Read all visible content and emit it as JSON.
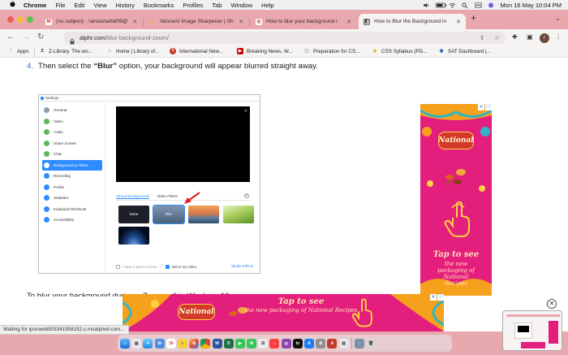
{
  "menubar": {
    "apple": "",
    "app_name": "Chrome",
    "items": [
      "File",
      "Edit",
      "View",
      "History",
      "Bookmarks",
      "Profiles",
      "Tab",
      "Window",
      "Help"
    ],
    "clock": "Mon 16 May  10:04 PM"
  },
  "tabs": [
    {
      "title": "(no subject) - raniashahid09@",
      "favicon": "M",
      "favicon_color": "#d93025"
    },
    {
      "title": "VanceAI Image Sharpener | Sh",
      "favicon": "▲",
      "favicon_color": "#f0a23a"
    },
    {
      "title": "How to blur your background i",
      "favicon": "◎",
      "favicon_color": "#b93b3b"
    },
    {
      "title": "How to Blur the Background in",
      "favicon": "◧",
      "favicon_color": "#444444"
    }
  ],
  "toolbar": {
    "url_host": "alphr.com",
    "url_path": "/blur-background-zoom/",
    "profile_initial": "r"
  },
  "bookmarks": [
    {
      "label": "Apps",
      "icon_color": "#555555",
      "icon": "⋮"
    },
    {
      "label": "Z-Library. The wo...",
      "icon_color": "#1b1b1b",
      "icon": "Z"
    },
    {
      "label": "Home | Library of...",
      "icon_color": "#666666",
      "icon": "⌂"
    },
    {
      "label": "International New...",
      "icon_color": "#c0392b",
      "icon": "T"
    },
    {
      "label": "Breaking News, W...",
      "icon_color": "#cc0000",
      "icon": "▶"
    },
    {
      "label": "Preparation for CS...",
      "icon_color": "#888888",
      "icon": "▢"
    },
    {
      "label": "CSS Syllabus (PD...",
      "icon_color": "#e0b21f",
      "icon": "◆"
    },
    {
      "label": "SAT Dashboard |...",
      "icon_color": "#1c5fa8",
      "icon": "◉"
    }
  ],
  "content": {
    "step_number": "4.",
    "step_prefix": "Then select the ",
    "step_bold": "“Blur”",
    "step_suffix": " option, your background will appear blurred straight away.",
    "clipped_line": "To blur your background during a Zoom call in Windows 10..."
  },
  "zoom_window": {
    "title": "Settings",
    "sidebar": [
      {
        "label": "General",
        "color": "#8aa0b0"
      },
      {
        "label": "Video",
        "color": "#5cb85c"
      },
      {
        "label": "Audio",
        "color": "#5cb85c"
      },
      {
        "label": "Share Screen",
        "color": "#5cb85c"
      },
      {
        "label": "Chat",
        "color": "#5cb85c"
      },
      {
        "label": "Background & Filters",
        "color": "#ffffff",
        "selected": true
      },
      {
        "label": "Recording",
        "color": "#2d8cff"
      },
      {
        "label": "Profile",
        "color": "#2d8cff"
      },
      {
        "label": "Statistics",
        "color": "#2d8cff"
      },
      {
        "label": "Keyboard Shortcuts",
        "color": "#2d8cff"
      },
      {
        "label": "Accessibility",
        "color": "#2d8cff"
      }
    ],
    "tab_virtual": "Virtual Backgrounds",
    "tab_filters": "Video Filters",
    "thumb_none": "None",
    "thumb_blur": "Blur",
    "green_screen": "I have a green screen",
    "mirror": "Mirror my video",
    "studio": "Studio Effects"
  },
  "ads": {
    "brand": "National",
    "tap": "Tap to see",
    "sub": "the new packaging of National Recipes"
  },
  "status_bar": "Waiting for iponweb503341958152.s.moatpixel.com...",
  "colors": {
    "tab_strip": "#e9a8ad",
    "ad_pink": "#e41e7d",
    "zoom_blue": "#2d8cff"
  }
}
